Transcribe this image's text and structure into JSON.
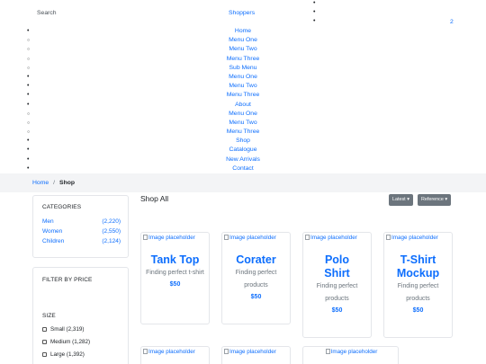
{
  "header": {
    "search_label": "Search",
    "brand": "Shoppers",
    "cart_count": "2"
  },
  "nav": {
    "items": [
      {
        "label": "Home",
        "bullet": "disc"
      },
      {
        "label": "Menu One",
        "bullet": "circle"
      },
      {
        "label": "Menu Two",
        "bullet": "circle"
      },
      {
        "label": "Menu Three",
        "bullet": "circle"
      },
      {
        "label": "Sub Menu",
        "bullet": "circle"
      },
      {
        "label": "Menu One",
        "bullet": "disc"
      },
      {
        "label": "Menu Two",
        "bullet": "disc"
      },
      {
        "label": "Menu Three",
        "bullet": "disc"
      },
      {
        "label": "About",
        "bullet": "disc"
      },
      {
        "label": "Menu One",
        "bullet": "circle"
      },
      {
        "label": "Menu Two",
        "bullet": "circle"
      },
      {
        "label": "Menu Three",
        "bullet": "circle"
      },
      {
        "label": "Shop",
        "bullet": "disc"
      },
      {
        "label": "Catalogue",
        "bullet": "disc"
      },
      {
        "label": "New Arrivals",
        "bullet": "disc"
      },
      {
        "label": "Contact",
        "bullet": "disc"
      }
    ]
  },
  "breadcrumb": {
    "home": "Home",
    "separator": "/",
    "current": "Shop"
  },
  "sidebar": {
    "categories_heading": "CATEGORIES",
    "categories": [
      {
        "name": "Men",
        "count": "(2,220)"
      },
      {
        "name": "Women",
        "count": "(2,550)"
      },
      {
        "name": "Children",
        "count": "(2,124)"
      }
    ],
    "filter_heading": "FILTER BY PRICE",
    "size_heading": "SIZE",
    "sizes": [
      {
        "label": "Small (2,319)"
      },
      {
        "label": "Medium (1,282)"
      },
      {
        "label": "Large (1,392)"
      }
    ]
  },
  "main": {
    "title": "Shop All",
    "sort_latest": "Latest",
    "sort_reference": "Reference",
    "image_alt": "Image placeholder",
    "products": [
      {
        "title": "Tank Top",
        "desc": "Finding perfect t-shirt",
        "price": "$50"
      },
      {
        "title": "Corater",
        "desc": "Finding perfect products",
        "price": "$50"
      },
      {
        "title": "Polo Shirt",
        "desc": "Finding perfect products",
        "price": "$50"
      },
      {
        "title": "T-Shirt Mockup",
        "desc": "Finding perfect products",
        "price": "$50"
      }
    ]
  },
  "colors": {
    "link": "#0d6efd",
    "button_secondary": "#6c757d",
    "breadcrumb_bg": "#f3f4f6"
  }
}
